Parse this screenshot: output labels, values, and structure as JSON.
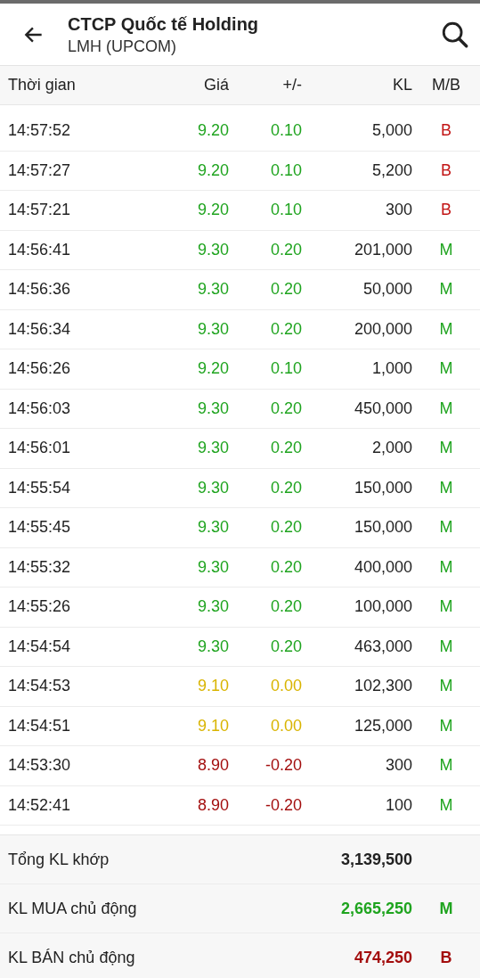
{
  "header": {
    "title": "CTCP Quốc tế Holding",
    "subtitle": "LMH (UPCOM)"
  },
  "columns": [
    "Thời gian",
    "Giá",
    "+/-",
    "KL",
    "M/B"
  ],
  "rows": [
    {
      "time": "14:57:52",
      "price": "9.20",
      "change": "0.10",
      "volume": "5,000",
      "side": "B",
      "color": "#1fa41f",
      "buy": false
    },
    {
      "time": "14:57:27",
      "price": "9.20",
      "change": "0.10",
      "volume": "5,200",
      "side": "B",
      "color": "#1fa41f",
      "buy": false
    },
    {
      "time": "14:57:21",
      "price": "9.20",
      "change": "0.10",
      "volume": "300",
      "side": "B",
      "color": "#1fa41f",
      "buy": false
    },
    {
      "time": "14:56:41",
      "price": "9.30",
      "change": "0.20",
      "volume": "201,000",
      "side": "M",
      "color": "#1fa41f",
      "buy": true
    },
    {
      "time": "14:56:36",
      "price": "9.30",
      "change": "0.20",
      "volume": "50,000",
      "side": "M",
      "color": "#1fa41f",
      "buy": true
    },
    {
      "time": "14:56:34",
      "price": "9.30",
      "change": "0.20",
      "volume": "200,000",
      "side": "M",
      "color": "#1fa41f",
      "buy": true
    },
    {
      "time": "14:56:26",
      "price": "9.20",
      "change": "0.10",
      "volume": "1,000",
      "side": "M",
      "color": "#1fa41f",
      "buy": true
    },
    {
      "time": "14:56:03",
      "price": "9.30",
      "change": "0.20",
      "volume": "450,000",
      "side": "M",
      "color": "#1fa41f",
      "buy": true
    },
    {
      "time": "14:56:01",
      "price": "9.30",
      "change": "0.20",
      "volume": "2,000",
      "side": "M",
      "color": "#1fa41f",
      "buy": true
    },
    {
      "time": "14:55:54",
      "price": "9.30",
      "change": "0.20",
      "volume": "150,000",
      "side": "M",
      "color": "#1fa41f",
      "buy": true
    },
    {
      "time": "14:55:45",
      "price": "9.30",
      "change": "0.20",
      "volume": "150,000",
      "side": "M",
      "color": "#1fa41f",
      "buy": true
    },
    {
      "time": "14:55:32",
      "price": "9.30",
      "change": "0.20",
      "volume": "400,000",
      "side": "M",
      "color": "#1fa41f",
      "buy": true
    },
    {
      "time": "14:55:26",
      "price": "9.30",
      "change": "0.20",
      "volume": "100,000",
      "side": "M",
      "color": "#1fa41f",
      "buy": true
    },
    {
      "time": "14:54:54",
      "price": "9.30",
      "change": "0.20",
      "volume": "463,000",
      "side": "M",
      "color": "#1fa41f",
      "buy": true
    },
    {
      "time": "14:54:53",
      "price": "9.10",
      "change": "0.00",
      "volume": "102,300",
      "side": "M",
      "color": "#d9b400",
      "buy": true
    },
    {
      "time": "14:54:51",
      "price": "9.10",
      "change": "0.00",
      "volume": "125,000",
      "side": "M",
      "color": "#d9b400",
      "buy": true
    },
    {
      "time": "14:53:30",
      "price": "8.90",
      "change": "-0.20",
      "volume": "300",
      "side": "M",
      "color": "#a30e0e",
      "buy": true
    },
    {
      "time": "14:52:41",
      "price": "8.90",
      "change": "-0.20",
      "volume": "100",
      "side": "M",
      "color": "#a30e0e",
      "buy": true
    }
  ],
  "summary": [
    {
      "label": "Tổng KL khớp",
      "value": "3,139,500",
      "color": "#222222"
    },
    {
      "label": "KL MUA chủ động",
      "value": "2,665,250",
      "side": "M",
      "color": "#1fa41f"
    },
    {
      "label": "KL BÁN chủ động",
      "value": "474,250",
      "side": "B",
      "color": "#a30e0e"
    }
  ]
}
